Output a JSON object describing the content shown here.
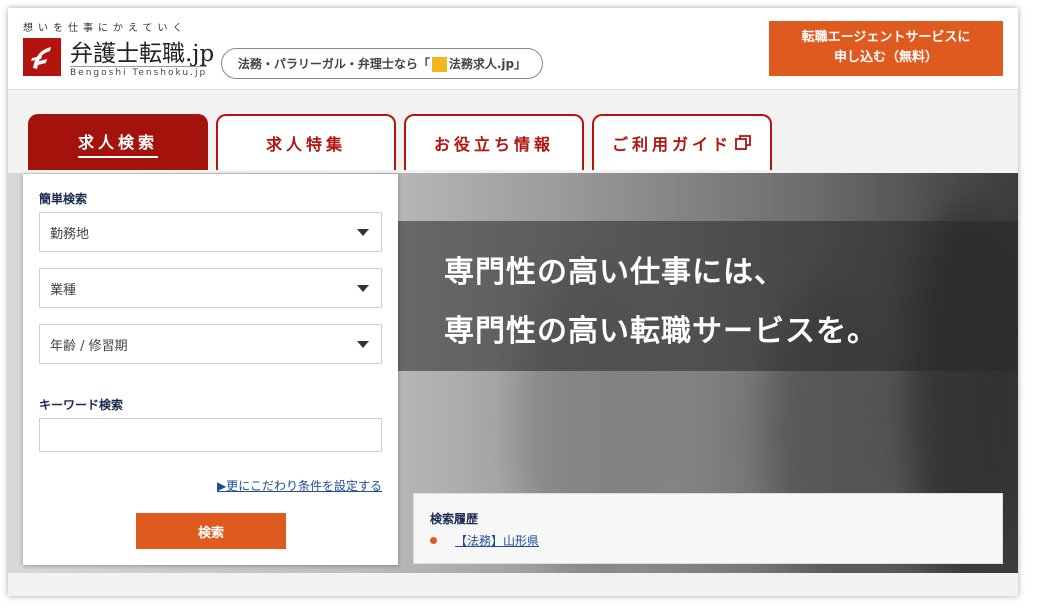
{
  "header": {
    "tagline": "想いを仕事にかえていく",
    "logo_text": "弁護士転職.jp",
    "logo_sub": "Bengoshi Tenshoku.jp",
    "partner_text_before": "法務・パラリーガル・弁理士なら「",
    "partner_brand": "法務求人.jp",
    "partner_text_after": "」",
    "agent_cta_line1": "転職エージェントサービスに",
    "agent_cta_line2": "申し込む（無料）"
  },
  "nav": {
    "tabs": [
      {
        "label": "求人検索",
        "active": true
      },
      {
        "label": "求人特集",
        "active": false
      },
      {
        "label": "お役立ち情報",
        "active": false
      },
      {
        "label": "ご利用ガイド",
        "active": false,
        "icon": "external-window-icon"
      }
    ]
  },
  "hero": {
    "line1": "専門性の高い仕事には、",
    "line2": "専門性の高い転職サービスを。"
  },
  "search": {
    "simple_title": "簡単検索",
    "location_select": "勤務地",
    "industry_select": "業種",
    "age_select": "年齢 / 修習期",
    "keyword_title": "キーワード検索",
    "keyword_value": "",
    "advanced_link": "▶更にこだわり条件を設定する",
    "submit_label": "検索"
  },
  "history": {
    "title": "検索履歴",
    "items": [
      "【法務】山形県"
    ]
  },
  "colors": {
    "brand_red": "#a3120b",
    "accent_orange": "#df5a1e",
    "link_blue": "#1f4c9a"
  }
}
